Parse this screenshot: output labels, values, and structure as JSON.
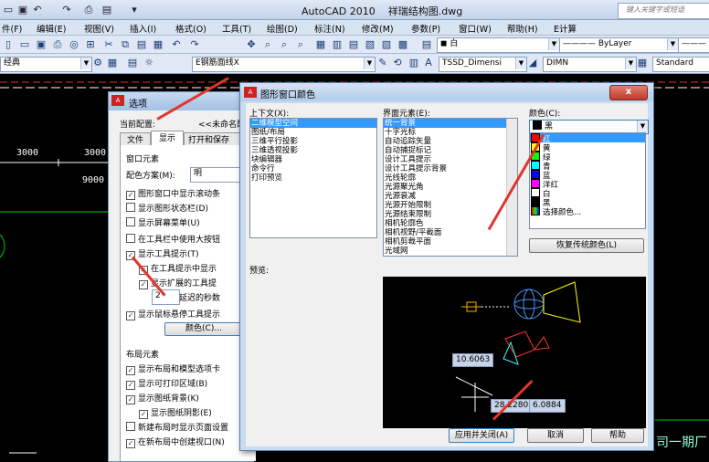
{
  "app": {
    "title": "AutoCAD 2010",
    "file": "祥瑞结构图.dwg",
    "search_placeholder": "键入关键字或短语"
  },
  "menu": [
    "件(F)",
    "编辑(E)",
    "视图(V)",
    "插入(I)",
    "格式(O)",
    "工具(T)",
    "绘图(D)",
    "标注(N)",
    "修改(M)",
    "参数(P)",
    "窗口(W)",
    "帮助(H)",
    "E计算"
  ],
  "toolbar": {
    "layer_combo": "白",
    "linetype_combo": "ByLayer",
    "workspace": "经典",
    "layer2": "E钢筋面线X",
    "dimstyle": "TSSD_Dimensi",
    "dimn": "DIMN",
    "textstyle": "Standard"
  },
  "drawing": {
    "labels": [
      "3000",
      "3000",
      "9000"
    ]
  },
  "options_dialog": {
    "title": "选项",
    "current_profile_label": "当前配置:",
    "current_profile_value": "<<未命名配",
    "tabs": [
      "文件",
      "显示",
      "打开和保存"
    ],
    "window_elements_label": "窗口元素",
    "color_scheme_label": "配色方案(M):",
    "color_scheme_value": "明",
    "checks": [
      {
        "label": "图形窗口中显示滚动条",
        "checked": true
      },
      {
        "label": "显示图形状态栏(D)",
        "checked": false
      },
      {
        "label": "显示屏幕菜单(U)",
        "checked": false
      },
      {
        "label": "在工具栏中使用大按钮",
        "checked": false
      },
      {
        "label": "显示工具提示(T)",
        "checked": true
      }
    ],
    "sub_checks": [
      {
        "label": "在工具提示中显示",
        "checked": true
      },
      {
        "label": "显示扩展的工具提",
        "checked": true
      }
    ],
    "delay_value": "2",
    "delay_label": "延迟的秒数",
    "rollover_label": "显示鼠标悬停工具提示",
    "colors_button": "颜色(C)...",
    "layout_elements_label": "布局元素",
    "layout_checks": [
      {
        "label": "显示布局和模型选项卡",
        "checked": true
      },
      {
        "label": "显示可打印区域(B)",
        "checked": true
      },
      {
        "label": "显示图纸背景(K)",
        "checked": true
      }
    ],
    "shadow_check": {
      "label": "显示图纸阴影(E)",
      "checked": true
    },
    "layout_checks2": [
      {
        "label": "新建布局时显示页面设置",
        "checked": false
      },
      {
        "label": "在新布局中创建视口(N)",
        "checked": true
      }
    ]
  },
  "color_dialog": {
    "title": "图形窗口颜色",
    "context_label": "上下文(X):",
    "contexts": [
      "二维模型空间",
      "图纸/布局",
      "三维平行投影",
      "三维透视投影",
      "块编辑器",
      "命令行",
      "打印预览"
    ],
    "interface_label": "界面元素(E):",
    "elements": [
      "统一背景",
      "十字光标",
      "自动追踪矢量",
      "自动捕捉标记",
      "设计工具提示",
      "设计工具提示背景",
      "光线轮廓",
      "光源聚光角",
      "光源衰减",
      "光源开始限制",
      "光源结束限制",
      "相机轮廓色",
      "相机视野/平截面",
      "相机剪裁平面",
      "光域网"
    ],
    "color_label": "颜色(C):",
    "color_value": "黑",
    "color_options": [
      {
        "name": "红",
        "hex": "#ff0000"
      },
      {
        "name": "黄",
        "hex": "#ffff00"
      },
      {
        "name": "绿",
        "hex": "#00ff00"
      },
      {
        "name": "青",
        "hex": "#00ffff"
      },
      {
        "name": "蓝",
        "hex": "#0000ff"
      },
      {
        "name": "洋红",
        "hex": "#ff00ff"
      },
      {
        "name": "白",
        "hex": "#ffffff"
      },
      {
        "name": "黑",
        "hex": "#000000"
      },
      {
        "name": "选择颜色...",
        "hex": "#888888"
      }
    ],
    "restore_button": "恢复传统颜色(L)",
    "preview_label": "预览:",
    "preview_values": [
      "10.6063",
      "28.2280",
      "6.0884"
    ],
    "apply_button": "应用并关闭(A)",
    "cancel_button": "取消",
    "help_button": "帮助"
  },
  "bottom_text": "司一期厂"
}
